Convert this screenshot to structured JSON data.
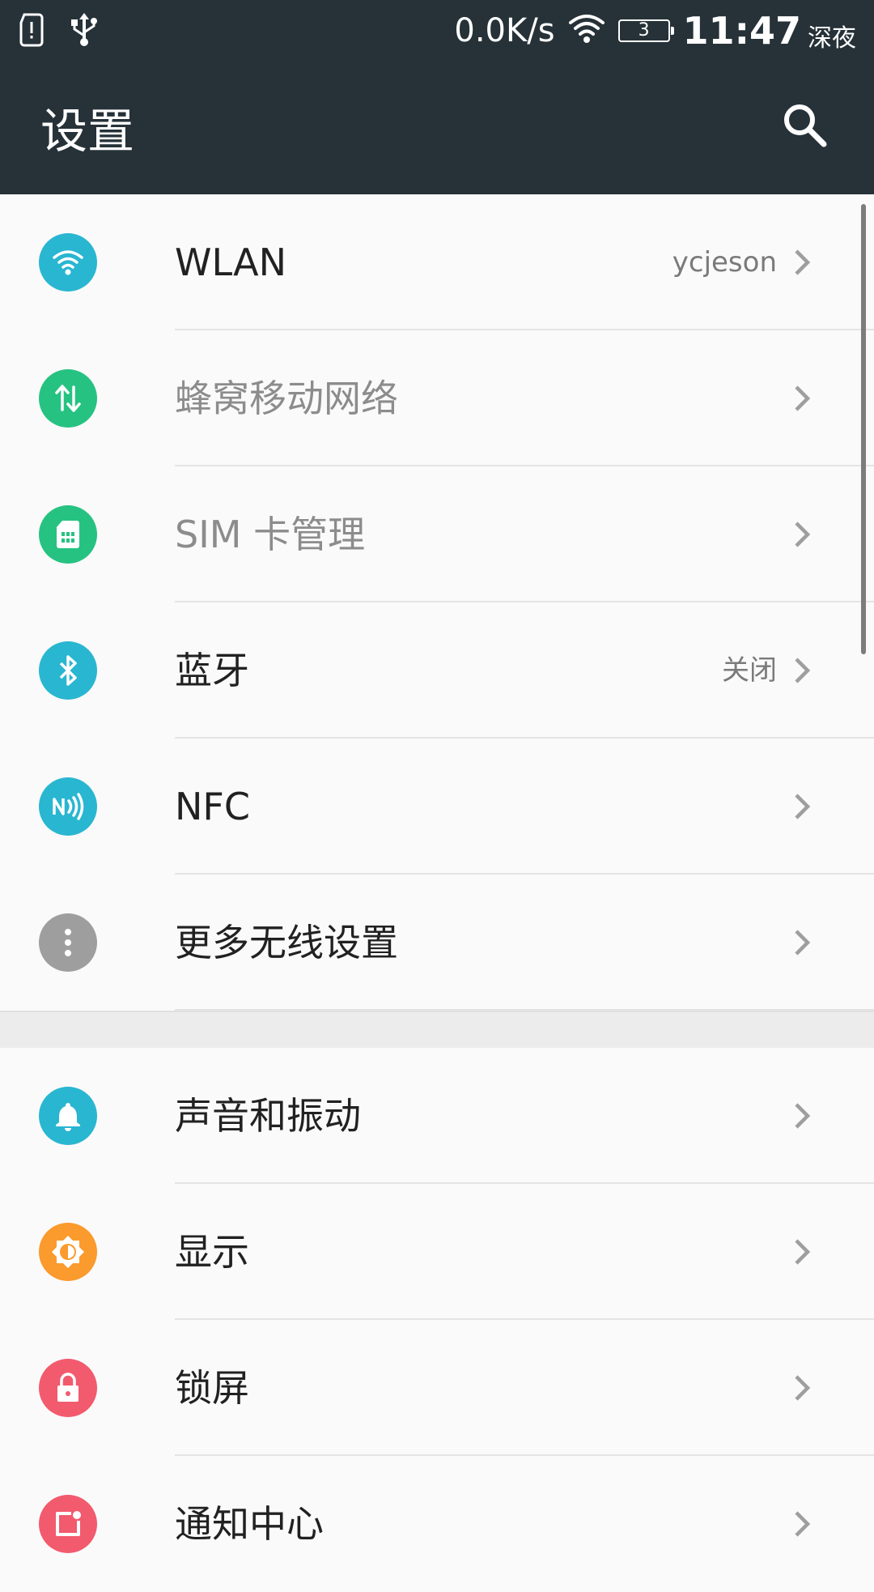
{
  "status_bar": {
    "speed": "0.0K/s",
    "battery": "3",
    "time": "11:47",
    "period": "深夜",
    "icons": [
      "sim-alert-icon",
      "usb-icon",
      "wifi-icon",
      "battery-icon"
    ]
  },
  "toolbar": {
    "title": "设置",
    "search_icon": "search-icon"
  },
  "groups": [
    {
      "items": [
        {
          "label": "WLAN",
          "value": "ycjeson",
          "icon": "wifi-icon",
          "color": "#29b6d1",
          "enabled": true
        },
        {
          "label": "蜂窝移动网络",
          "value": "",
          "icon": "cellular-data-icon",
          "color": "#26c281",
          "enabled": false
        },
        {
          "label": "SIM 卡管理",
          "value": "",
          "icon": "sim-card-icon",
          "color": "#26c281",
          "enabled": false
        },
        {
          "label": "蓝牙",
          "value": "关闭",
          "icon": "bluetooth-icon",
          "color": "#29b6d1",
          "enabled": true
        },
        {
          "label": "NFC",
          "value": "",
          "icon": "nfc-icon",
          "color": "#29b6d1",
          "enabled": true
        },
        {
          "label": "更多无线设置",
          "value": "",
          "icon": "more-icon",
          "color": "#9e9e9e",
          "enabled": true
        }
      ]
    },
    {
      "items": [
        {
          "label": "声音和振动",
          "value": "",
          "icon": "bell-icon",
          "color": "#29b6d1",
          "enabled": true
        },
        {
          "label": "显示",
          "value": "",
          "icon": "brightness-icon",
          "color": "#fb9a2d",
          "enabled": true
        },
        {
          "label": "锁屏",
          "value": "",
          "icon": "lock-icon",
          "color": "#f25a6e",
          "enabled": true
        },
        {
          "label": "通知中心",
          "value": "",
          "icon": "notification-icon",
          "color": "#f25a6e",
          "enabled": true
        }
      ]
    }
  ]
}
